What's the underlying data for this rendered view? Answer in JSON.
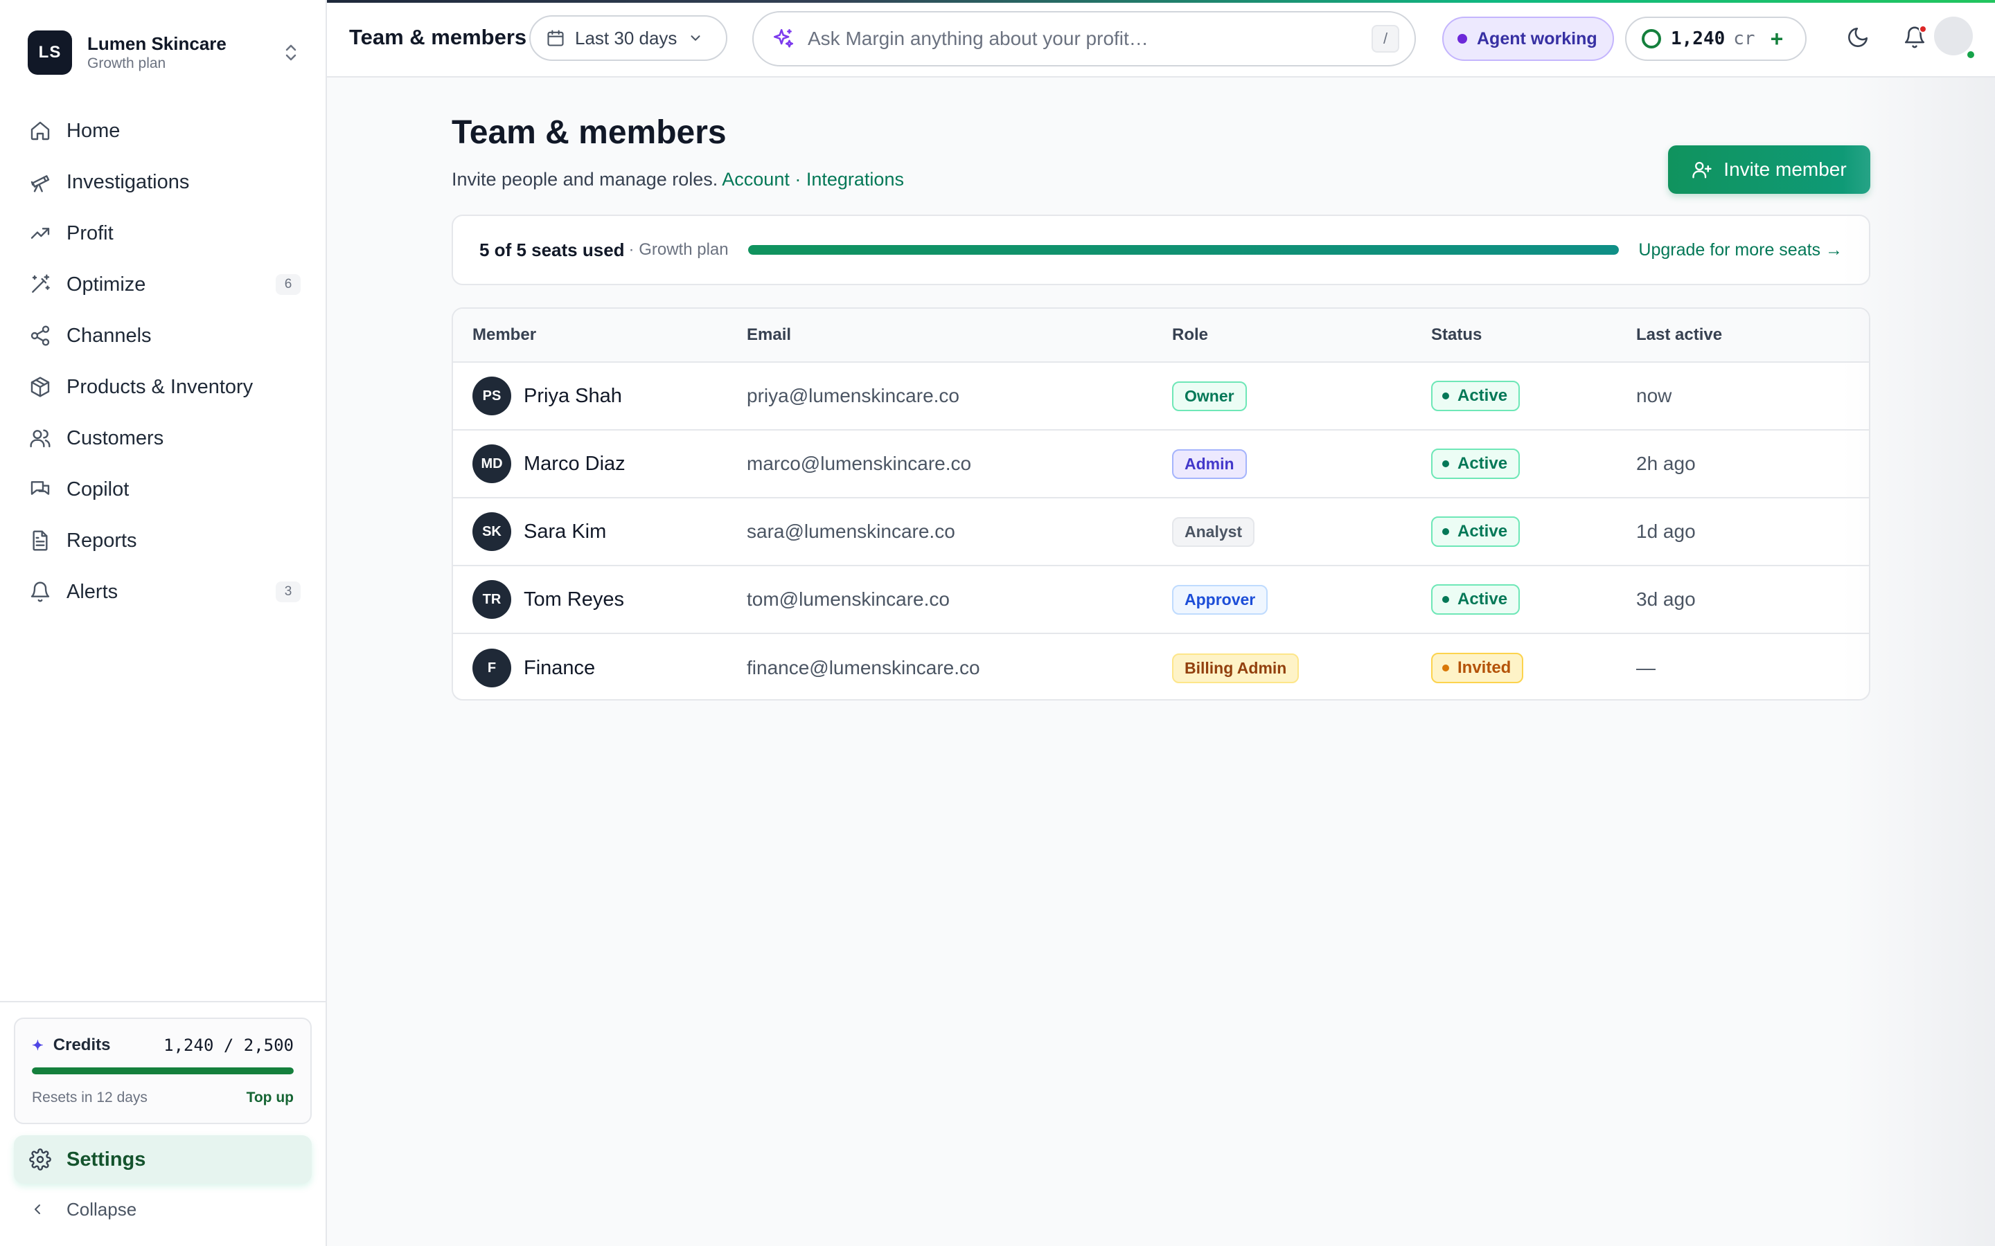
{
  "org": {
    "initials": "LS",
    "name": "Lumen Skincare",
    "plan": "Growth plan"
  },
  "nav": [
    {
      "label": "Home",
      "icon": "home-icon"
    },
    {
      "label": "Investigations",
      "icon": "telescope-icon"
    },
    {
      "label": "Profit",
      "icon": "trending-up-icon"
    },
    {
      "label": "Optimize",
      "icon": "magic-wand-icon",
      "badge": "6"
    },
    {
      "label": "Channels",
      "icon": "share-nodes-icon"
    },
    {
      "label": "Products & Inventory",
      "icon": "box-icon"
    },
    {
      "label": "Customers",
      "icon": "users-icon"
    },
    {
      "label": "Copilot",
      "icon": "chat-bubbles-icon"
    },
    {
      "label": "Reports",
      "icon": "document-icon"
    },
    {
      "label": "Alerts",
      "icon": "bell-icon",
      "badge": "3"
    }
  ],
  "credits_card": {
    "label": "Credits",
    "value": "1,240 / 2,500",
    "used_fraction": 1,
    "reset_text": "Resets in 12 days",
    "topup_label": "Top up"
  },
  "settings_label": "Settings",
  "collapse_label": "Collapse",
  "topbar": {
    "title": "Team & members",
    "date_range": "Last 30 days",
    "ask_placeholder": "Ask Margin anything about your profit…",
    "ask_shortcut": "/",
    "agent_status": "Agent working",
    "credits_value": "1,240",
    "credits_unit": "cr"
  },
  "page": {
    "title": "Team & members",
    "subtitle": "Invite people and manage roles.",
    "link_account": "Account",
    "link_sep": "·",
    "link_integrations": "Integrations",
    "invite_label": "Invite member"
  },
  "seats": {
    "used_text": "5 of 5 seats used",
    "plan_text": "· Growth plan",
    "fill_fraction": 1,
    "upgrade_text": "Upgrade for more seats →"
  },
  "table": {
    "headers": [
      "Member",
      "Email",
      "Role",
      "Status",
      "Last active"
    ],
    "rows": [
      {
        "initials": "PS",
        "name": "Priya Shah",
        "email": "priya@lumenskincare.co",
        "role": "Owner",
        "status": "Active",
        "last_active": "now"
      },
      {
        "initials": "MD",
        "name": "Marco Diaz",
        "email": "marco@lumenskincare.co",
        "role": "Admin",
        "status": "Active",
        "last_active": "2h ago"
      },
      {
        "initials": "SK",
        "name": "Sara Kim",
        "email": "sara@lumenskincare.co",
        "role": "Analyst",
        "status": "Active",
        "last_active": "1d ago"
      },
      {
        "initials": "TR",
        "name": "Tom Reyes",
        "email": "tom@lumenskincare.co",
        "role": "Approver",
        "status": "Active",
        "last_active": "3d ago"
      },
      {
        "initials": "F",
        "name": "Finance",
        "email": "finance@lumenskincare.co",
        "role": "Billing Admin",
        "status": "Invited",
        "last_active": "—"
      }
    ]
  },
  "colors": {
    "accent": "#10935e",
    "agent": "#6d28d9",
    "active_status": "#047857",
    "invited_status": "#b45309"
  }
}
